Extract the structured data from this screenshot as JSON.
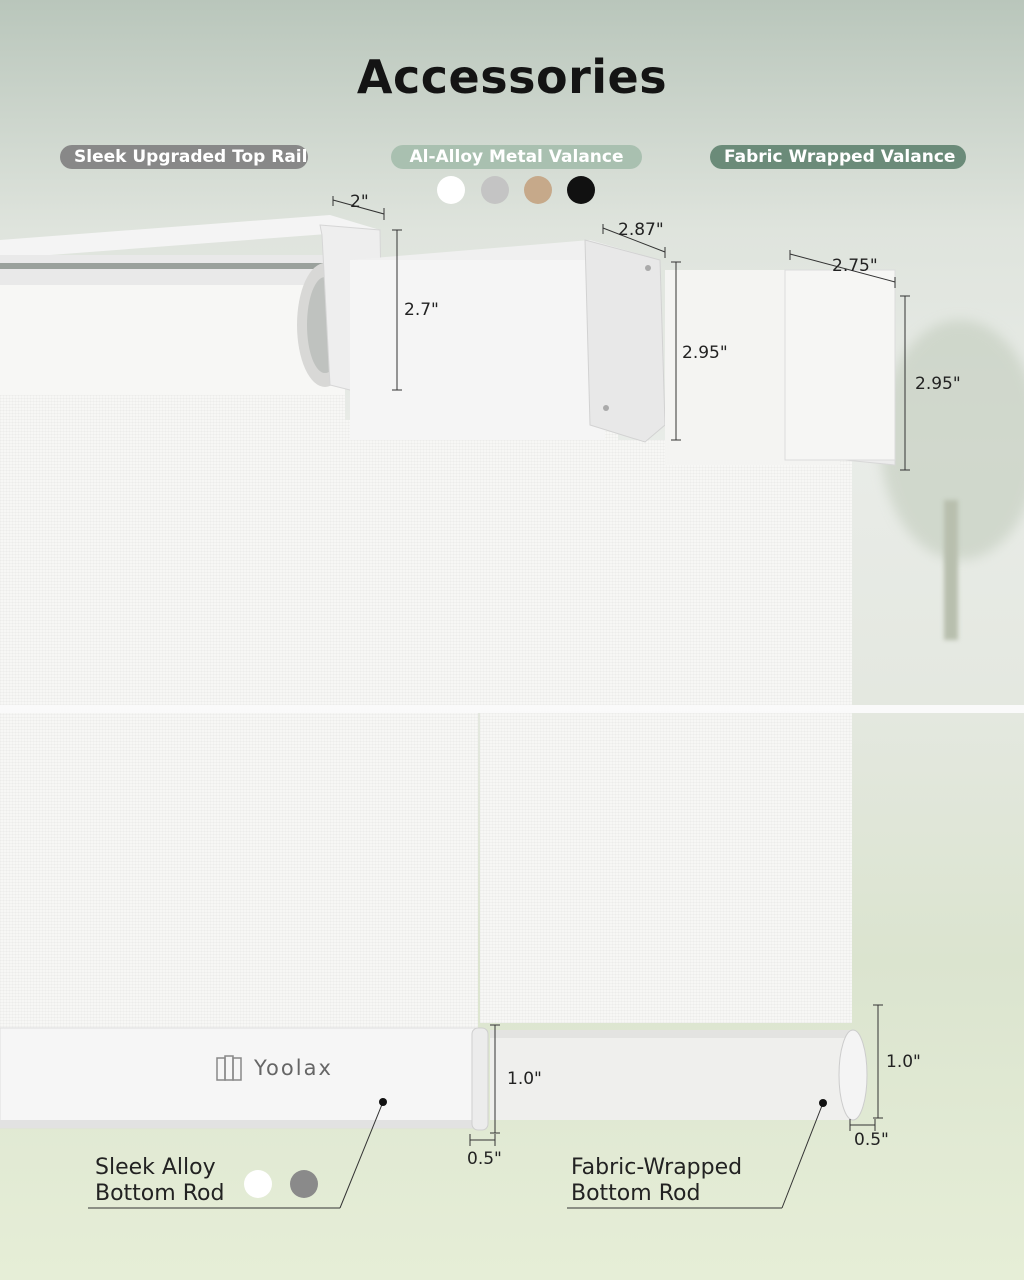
{
  "title": "Accessories",
  "labels": {
    "top_rail": "Sleek Upgraded Top Rail",
    "metal_valance": "Al-Alloy Metal Valance",
    "fabric_valance": "Fabric Wrapped Valance"
  },
  "colors": {
    "top_rail_pill": "#888888",
    "metal_valance_pill": "#a9c0b0",
    "fabric_valance_pill": "#6b8b79",
    "metal_valance_options": [
      "#ffffff",
      "#c4c4c4",
      "#c6a98a",
      "#111111"
    ],
    "bottom_rod_options": [
      "#ffffff",
      "#8a8a8a"
    ]
  },
  "dimensions": {
    "rail_depth": "2\"",
    "rail_height": "2.7\"",
    "metal_depth": "2.87\"",
    "metal_height": "2.95\"",
    "fabric_depth": "2.75\"",
    "fabric_height": "2.95\"",
    "alloy_rod_height": "1.0\"",
    "alloy_rod_depth": "0.5\"",
    "fabric_rod_height": "1.0\"",
    "fabric_rod_depth": "0.5\""
  },
  "brand": "Yoolax",
  "captions": {
    "alloy_rod_line1": "Sleek Alloy",
    "alloy_rod_line2": "Bottom Rod",
    "fabric_rod_line1": "Fabric-Wrapped",
    "fabric_rod_line2": "Bottom Rod"
  }
}
